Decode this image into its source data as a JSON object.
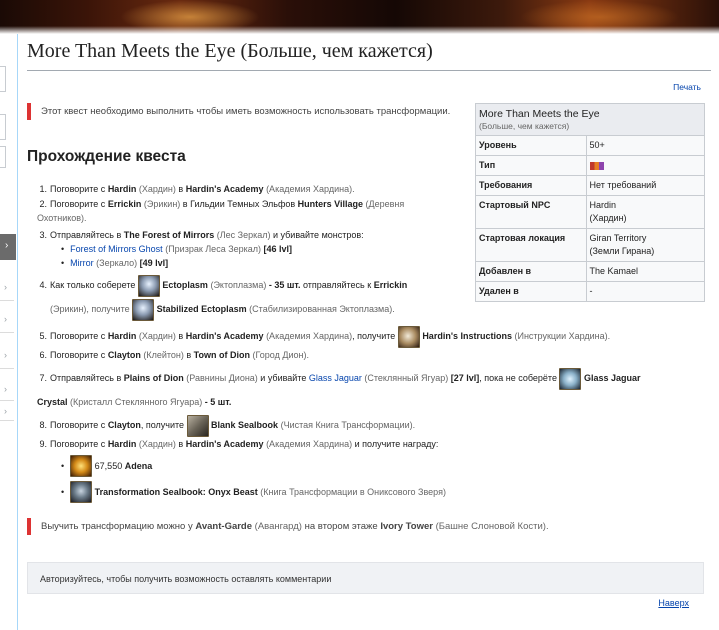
{
  "page": {
    "title": "More Than Meets the Eye (Больше, чем кажется)",
    "print_label": "Печать"
  },
  "notices": {
    "top": "Этот квест необходимо выполнить чтобы иметь возможность использовать трансформации.",
    "bottom_pre": "Выучить трансформацию можно у ",
    "bottom_npc": "Avant-Garde",
    "bottom_npc_ru": "(Авангард)",
    "bottom_mid": " на втором этаже ",
    "bottom_place": "Ivory Tower",
    "bottom_place_ru": "(Башне Слоновой Кости)."
  },
  "section": {
    "heading": "Прохождение квеста"
  },
  "steps": {
    "s1": {
      "num": "1.",
      "a": "Поговорите с ",
      "npc": "Hardin",
      "npc_ru": "(Хардин)",
      "b": " в ",
      "place": "Hardin's Academy",
      "place_ru": "(Академия Хардина)."
    },
    "s2": {
      "num": "2.",
      "a": "Поговорите с ",
      "npc": "Errickin",
      "npc_ru": "(Эрикин)",
      "b": " в Гильдии Темных Эльфов ",
      "place": "Hunters Village",
      "place_ru": "(Деревня Охотников)."
    },
    "s3": {
      "num": "3.",
      "a": "Отправляйтесь в ",
      "place": "The Forest of Mirrors",
      "place_ru": "(Лес Зеркал)",
      "b": " и убивайте монстров:",
      "m1": "Forest of Mirrors Ghost",
      "m1_ru": "(Призрак Леса Зеркал)",
      "m1_lvl": "[46 lvl]",
      "m2": "Mirror",
      "m2_ru": "(Зеркало)",
      "m2_lvl": "[49 lvl]"
    },
    "s4": {
      "num": "4.",
      "a": "Как только соберете ",
      "item": "Ectoplasm",
      "item_ru": "(Эктоплазма)",
      "b": " - 35 шт.",
      "c": " отправляйтесь к ",
      "npc": "Errickin",
      "npc_ru": "(Эрикин), получите ",
      "item2": "Stabilized Ectoplasm",
      "item2_ru": "(Стабилизированная Эктоплазма)."
    },
    "s5": {
      "num": "5.",
      "a": "Поговорите с ",
      "npc": "Hardin",
      "npc_ru": "(Хардин)",
      "b": " в ",
      "place": "Hardin's Academy",
      "place_ru": "(Академия Хардина)",
      "c": ", получите ",
      "item": "Hardin's Instructions",
      "item_ru": "(Инструкции Хардина)."
    },
    "s6": {
      "num": "6.",
      "a": "Поговорите с ",
      "npc": "Clayton",
      "npc_ru": "(Клейтон)",
      "b": " в ",
      "place": "Town of Dion",
      "place_ru": "(Город Дион)."
    },
    "s7": {
      "num": "7.",
      "a": "Отправляйтесь в ",
      "place": "Plains of Dion",
      "place_ru": "(Равнины Диона)",
      "b": " и убивайте ",
      "mob": "Glass Jaguar",
      "mob_ru": "(Стеклянный Ягуар)",
      "lvl": "[27 lvl]",
      "c": ", пока не соберёте ",
      "item": "Glass Jaguar",
      "item2": "Crystal",
      "item_ru": "(Кристалл Стеклянного Ягуара)",
      "d": " - 5 шт."
    },
    "s8": {
      "num": "8.",
      "a": "Поговорите с ",
      "npc": "Clayton",
      "b": ", получите ",
      "item": "Blank Sealbook",
      "item_ru": "(Чистая Книга Трансформации)."
    },
    "s9": {
      "num": "9.",
      "a": "Поговорите с ",
      "npc": "Hardin",
      "npc_ru": "(Хардин)",
      "b": " в ",
      "place": "Hardin's Academy",
      "place_ru": "(Академия Хардина)",
      "c": " и получите награду:",
      "r1_amount": "67,550",
      "r1_item": "Adena",
      "r2_item": "Transformation Sealbook: Onyx Beast",
      "r2_ru": "(Книга Трансформации в Ониксового Зверя)"
    }
  },
  "infobox": {
    "title": "More Than Meets the Eye",
    "subtitle": "(Больше, чем кажется)",
    "rows": {
      "level": {
        "k": "Уровень",
        "v": "50+"
      },
      "type": {
        "k": "Тип"
      },
      "req": {
        "k": "Требования",
        "v": "Нет требований"
      },
      "npc": {
        "k": "Стартовый NPC",
        "v1": "Hardin",
        "v2": "(Хардин)"
      },
      "loc": {
        "k": "Стартовая локация",
        "v1": "Giran Territory",
        "v2": "(Земли Гирана)"
      },
      "added": {
        "k": "Добавлен в",
        "v": "The Kamael"
      },
      "removed": {
        "k": "Удален в",
        "v": "-"
      }
    }
  },
  "comments": {
    "prompt": "Авторизуйтесь, чтобы получить возможность оставлять комментарии",
    "up_label": "Наверх"
  },
  "colors": {
    "link": "#0645ad",
    "notice_accent": "#dd3333",
    "muted": "#666666"
  }
}
